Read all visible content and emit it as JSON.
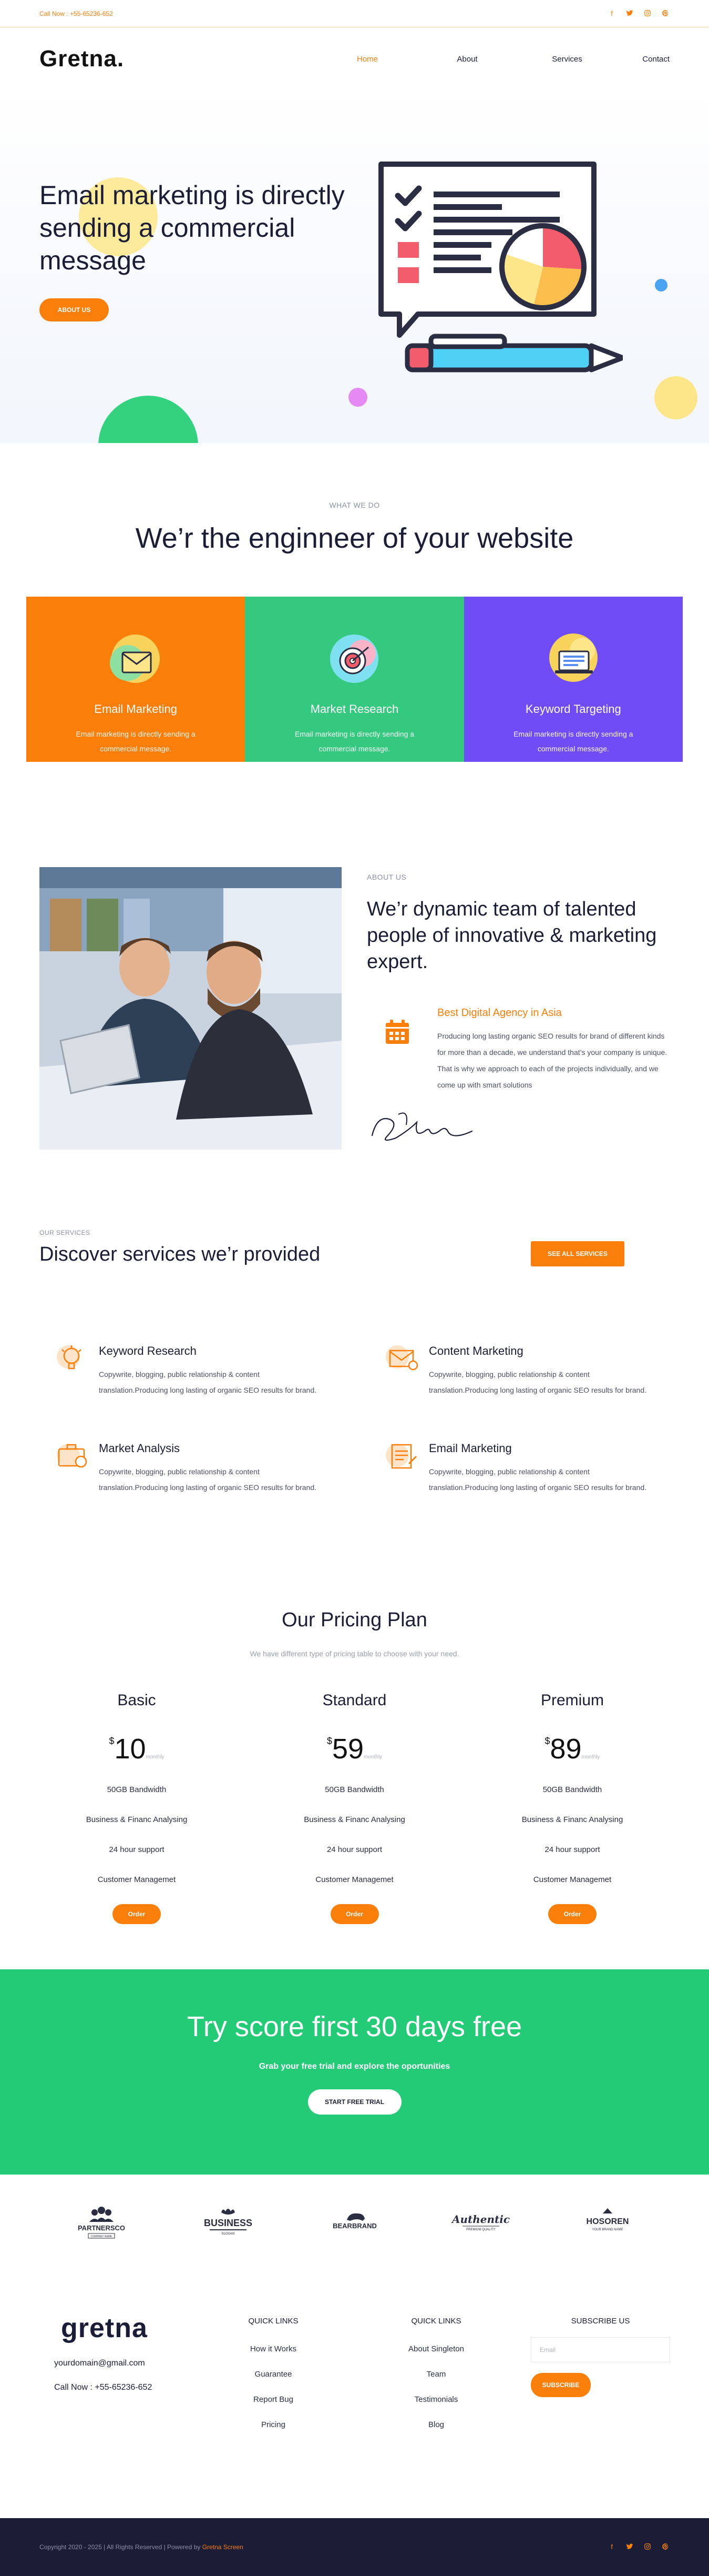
{
  "topbar": {
    "phone": "Call Now : +55-65236-652",
    "socials": [
      "facebook-icon",
      "twitter-icon",
      "instagram-icon",
      "pinterest-icon"
    ]
  },
  "nav": {
    "logo": "Gretna.",
    "items": [
      "Home",
      "About",
      "Services",
      "Contact"
    ]
  },
  "hero": {
    "title": "Email marketing is directly sending a commercial message",
    "button": "ABOUT US"
  },
  "what_we_do": {
    "eyebrow": "WHAT WE DO",
    "title": "We’r the enginneer of your website",
    "cards": [
      {
        "title": "Email Marketing",
        "text": "Email marketing is directly sending a commercial message.",
        "color": "#fa7e0a",
        "icon": "envelope-icon"
      },
      {
        "title": "Market Research",
        "text": "Email marketing is directly sending a commercial message.",
        "color": "#34c97f",
        "icon": "target-icon"
      },
      {
        "title": "Keyword Targeting",
        "text": "Email marketing is directly sending a commercial message.",
        "color": "#6f4cf6",
        "icon": "laptop-icon"
      }
    ]
  },
  "about": {
    "eyebrow": "ABOUT US",
    "title": "We’r dynamic team of talented people of innovative & marketing expert.",
    "subtitle": "Best Digital Agency in Asia",
    "text": "Producing long lasting organic SEO results for brand of different kinds for more than a decade, we understand that’s your company is unique. That is why we approach to each of the projects individually, and we come up with smart solutions"
  },
  "services": {
    "eyebrow": "OUR SERVICES",
    "title": "Discover services we’r provided",
    "button": "SEE ALL SERVICES",
    "items": [
      {
        "title": "Keyword Research",
        "text": "Copywrite, blogging, public relationship & content translation.Producing long lasting of organic SEO results for brand.",
        "icon": "lightbulb-icon"
      },
      {
        "title": "Content Marketing",
        "text": "Copywrite, blogging, public relationship & content translation.Producing long lasting of organic SEO results for brand.",
        "icon": "mail-gear-icon"
      },
      {
        "title": "Market Analysis",
        "text": "Copywrite, blogging, public relationship & content translation.Producing long lasting of organic SEO results for brand.",
        "icon": "briefcase-chart-icon"
      },
      {
        "title": "Email Marketing",
        "text": "Copywrite, blogging, public relationship & content translation.Producing long lasting of organic SEO results for brand.",
        "icon": "document-icon"
      }
    ]
  },
  "pricing": {
    "title": "Our Pricing Plan",
    "subtitle": "We have different type of pricing table to choose with your need.",
    "plans": [
      {
        "name": "Basic",
        "currency": "$",
        "price": "10",
        "period": "monthly",
        "features": [
          "50GB Bandwidth",
          "Business & Financ Analysing",
          "24 hour support",
          "Customer Managemet"
        ],
        "button": "Order"
      },
      {
        "name": "Standard",
        "currency": "$",
        "price": "59",
        "period": "monthly",
        "features": [
          "50GB Bandwidth",
          "Business & Financ Analysing",
          "24 hour support",
          "Customer Managemet"
        ],
        "button": "Order"
      },
      {
        "name": "Premium",
        "currency": "$",
        "price": "89",
        "period": "monthly",
        "features": [
          "50GB Bandwidth",
          "Business & Financ Analysing",
          "24 hour support",
          "Customer Managemet"
        ],
        "button": "Order"
      }
    ]
  },
  "cta": {
    "title": "Try score first 30 days free",
    "subtitle": "Grab your free trial and explore the oportunities",
    "button": "START FREE TRIAL"
  },
  "brands": [
    {
      "name": "PARTNERSCO",
      "tag": "COMPANY NAME"
    },
    {
      "name": "BUSINESS",
      "tag": "SLOGAN"
    },
    {
      "name": "BEARBRAND",
      "tag": ""
    },
    {
      "name": "Authentic",
      "tag": "PREMIUM QUALITY"
    },
    {
      "name": "HOSOREN",
      "tag": "YOUR BRAND NAME"
    }
  ],
  "footer": {
    "logo": "gretna",
    "email": "yourdomain@gmail.com",
    "call": "Call Now : +55-65236-652",
    "quick1": {
      "title": "QUICK LINKS",
      "items": [
        "How it Works",
        "Guarantee",
        "Report Bug",
        "Pricing"
      ]
    },
    "quick2": {
      "title": "QUICK LINKS",
      "items": [
        "About Singleton",
        "Team",
        "Testimonials",
        "Blog"
      ]
    },
    "subscribe": {
      "title": "SUBSCRIBE US",
      "placeholder": "Email",
      "button": "SUBSCRIBE"
    },
    "copyright_prefix": "Copyright 2020 - 2025 | All Rights Reserved | Powered by",
    "copyright_brand": "Gretna Screen"
  }
}
